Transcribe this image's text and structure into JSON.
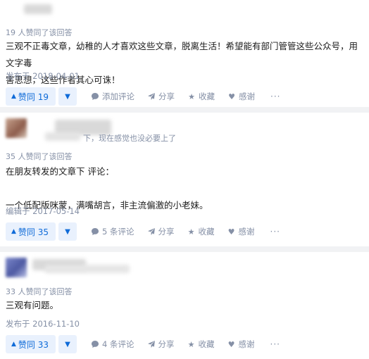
{
  "answers": [
    {
      "author_partial": "",
      "votes_summary": "19 人赞同了该回答",
      "content_lines": [
        "三观不正毒文章，幼稚的人才喜欢这些文章，脱离生活！希望能有部门管管这些公众号，用文字毒",
        "害思想，这些作者其心可诛！"
      ],
      "date": "发布于 2018-04-01",
      "vote_label": "赞同 19",
      "comment_label": "添加评论",
      "share_label": "分享",
      "collect_label": "收藏",
      "thanks_label": "感谢",
      "more_label": "···"
    },
    {
      "author_partial": "下，现在感觉也没必要上了",
      "votes_summary": "35 人赞同了该回答",
      "content_lines": [
        "在朋友转发的文章下 评论：",
        "",
        "一个低配版咪蒙，满嘴胡言，非主流偏激的小老妹。"
      ],
      "date": "编辑于 2017-05-14",
      "vote_label": "赞同 35",
      "comment_label": "5 条评论",
      "share_label": "分享",
      "collect_label": "收藏",
      "thanks_label": "感谢",
      "more_label": "···"
    },
    {
      "author_partial": "",
      "votes_summary": "33 人赞同了该回答",
      "content_lines": [
        "三观有问题。"
      ],
      "date": "发布于 2016-11-10",
      "vote_label": "赞同 33",
      "comment_label": "4 条评论",
      "share_label": "分享",
      "collect_label": "收藏",
      "thanks_label": "感谢",
      "more_label": "···"
    }
  ],
  "colors": {
    "accent": "#0f6bd8",
    "accent_bg": "#e9f1fd",
    "meta": "#8590a6",
    "divider": "#f1f2f4"
  },
  "icons": {
    "vote_up": "triangle-up-icon",
    "vote_down": "triangle-down-icon",
    "comment": "comment-bubble-icon",
    "share": "paper-plane-icon",
    "collect": "star-icon",
    "thanks": "heart-icon",
    "more": "ellipsis-icon"
  }
}
